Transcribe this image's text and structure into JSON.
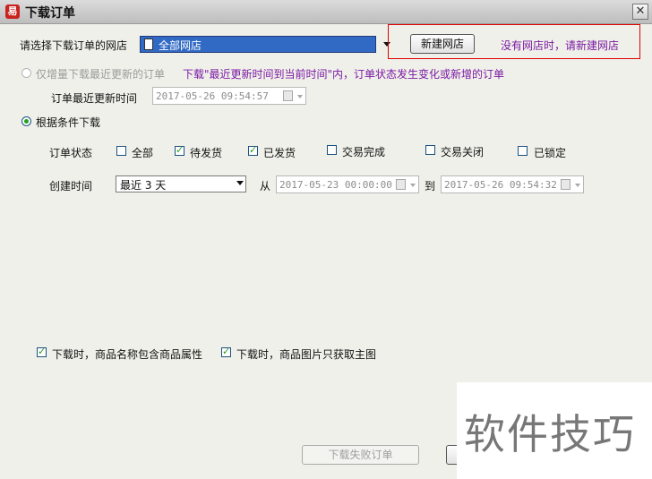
{
  "window": {
    "title": "下载订单",
    "app_icon_glyph": "易",
    "close_glyph": "✕"
  },
  "shop": {
    "label": "请选择下载订单的网店",
    "selected": "全部网店",
    "new_button": "新建网店",
    "hint": "没有网店时，请新建网店"
  },
  "incremental": {
    "label": "仅增量下载最近更新的订单",
    "note": "下载\"最近更新时间到当前时间\"内，订单状态发生变化或新增的订单",
    "time_label": "订单最近更新时间",
    "time_value": "2017-05-26 09:54:57"
  },
  "conditional": {
    "label": "根据条件下载",
    "status_label": "订单状态",
    "statuses": [
      {
        "label": "全部",
        "checked": false
      },
      {
        "label": "待发货",
        "checked": true
      },
      {
        "label": "已发货",
        "checked": true
      },
      {
        "label": "交易完成",
        "checked": false
      },
      {
        "label": "交易关闭",
        "checked": false
      },
      {
        "label": "已锁定",
        "checked": false
      }
    ],
    "created_label": "创建时间",
    "range_selected": "最近 3 天",
    "from_label": "从",
    "from_value": "2017-05-23 00:00:00",
    "to_label": "到",
    "to_value": "2017-05-26 09:54:32"
  },
  "options": [
    {
      "label": "下载时，商品名称包含商品属性",
      "checked": true
    },
    {
      "label": "下载时，商品图片只获取主图",
      "checked": true
    }
  ],
  "footer": {
    "failed_button": "下载失败订单"
  },
  "watermark": {
    "text": "软件技巧"
  },
  "colors": {
    "accent_selection": "#316ac5",
    "hint_purple": "#7a1aa3",
    "highlight_border": "#e00000",
    "check_green": "#21a121"
  }
}
